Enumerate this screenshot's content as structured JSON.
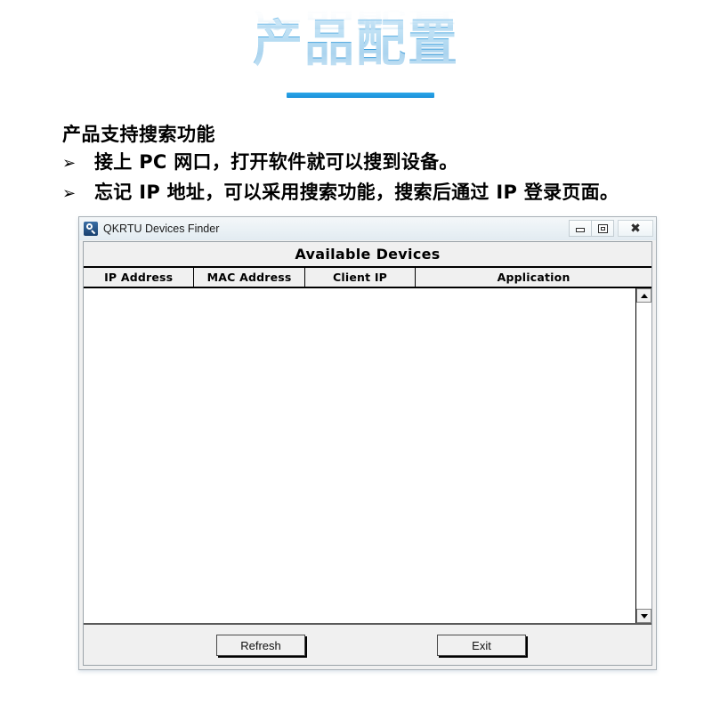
{
  "slide": {
    "title": "产品配置",
    "heading": "产品支持搜索功能",
    "bullets": [
      {
        "marker": "➢",
        "text": "接上 PC 网口，打开软件就可以搜到设备。"
      },
      {
        "marker": "➢",
        "text": "忘记 IP 地址，可以采用搜索功能，搜索后通过 IP 登录页面。"
      }
    ],
    "accent_color": "#1b90da",
    "title_gradient_top": "#8cc8ee",
    "title_gradient_bottom": "#2f94d6"
  },
  "window": {
    "icon": "magnifier-icon",
    "title": "QKRTU Devices Finder",
    "controls": {
      "minimize": "minimize-icon",
      "maximize": "maximize-icon",
      "close": "close-icon"
    },
    "panel_title": "Available Devices",
    "table": {
      "columns": [
        {
          "label": "IP Address",
          "width_pct": 19.5
        },
        {
          "label": "MAC Address",
          "width_pct": 19.5
        },
        {
          "label": "Client IP",
          "width_pct": 19.5
        },
        {
          "label": "Application",
          "width_pct": 41.5
        }
      ],
      "rows": [],
      "empty": true
    },
    "scrollbar": {
      "up_arrow": "arrow-up-icon",
      "down_arrow": "arrow-down-icon"
    },
    "buttons": {
      "refresh": "Refresh",
      "exit": "Exit"
    }
  }
}
